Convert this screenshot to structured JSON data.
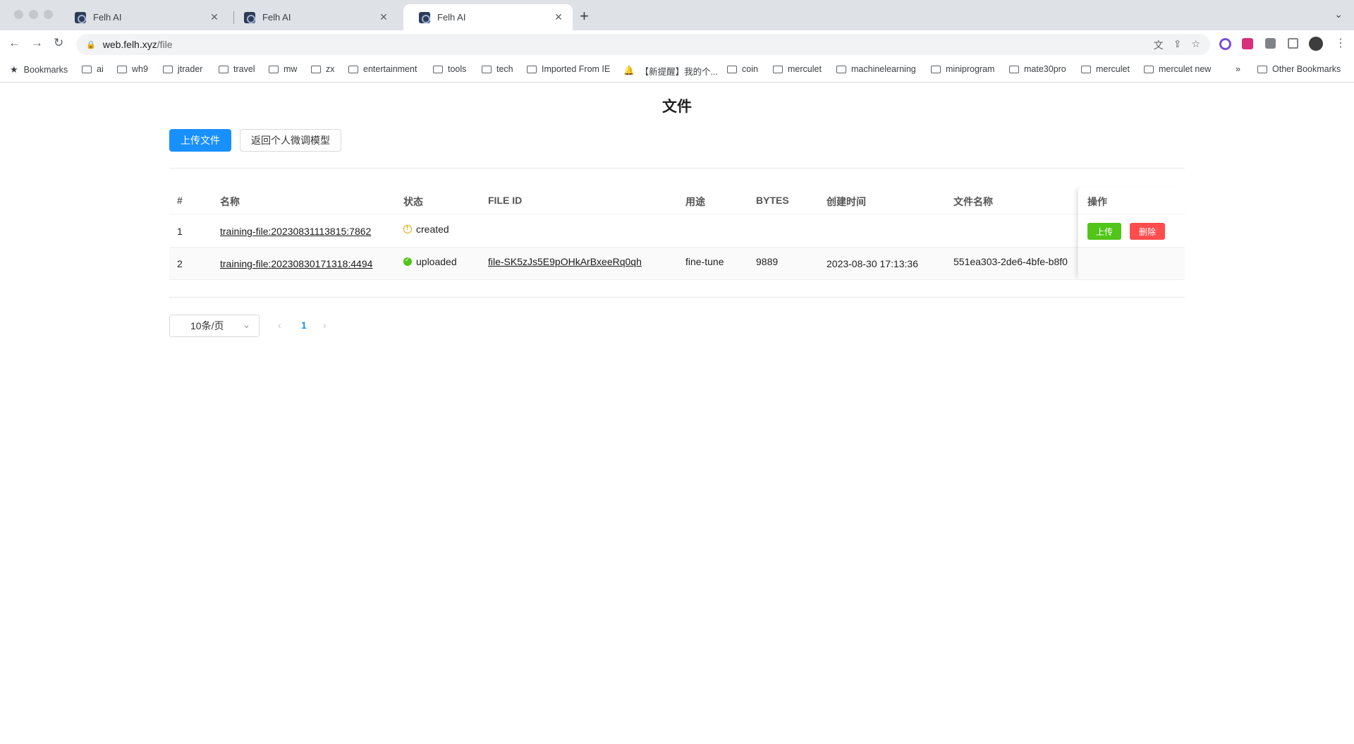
{
  "browser": {
    "tabs": [
      {
        "title": "Felh AI"
      },
      {
        "title": "Felh AI"
      },
      {
        "title": "Felh AI"
      }
    ],
    "url_host": "web.felh.xyz",
    "url_path": "/file",
    "bookmarks_label": "Bookmarks",
    "bookmarks": [
      "ai",
      "wh9",
      "jtrader",
      "travel",
      "mw",
      "zx",
      "entertainment",
      "tools",
      "tech",
      "Imported From IE",
      "【新提醒】我的个...",
      "coin",
      "merculet",
      "machinelearning",
      "miniprogram",
      "mate30pro",
      "merculet",
      "merculet new"
    ],
    "other_bookmarks": "Other Bookmarks",
    "more_glyph": "»"
  },
  "page": {
    "title": "文件",
    "upload_button": "上传文件",
    "back_button": "返回个人微调模型"
  },
  "table": {
    "columns": [
      "#",
      "名称",
      "状态",
      "FILE ID",
      "用途",
      "BYTES",
      "创建时间",
      "文件名称",
      "操作"
    ],
    "rows": [
      {
        "index": "1",
        "name": "training-file:20230831113815:7862",
        "status": "created",
        "file_id": "",
        "purpose": "",
        "bytes": "",
        "created_at": "",
        "file_name": "",
        "action_upload": "上传",
        "action_delete": "删除"
      },
      {
        "index": "2",
        "name": "training-file:20230830171318:4494",
        "status": "uploaded",
        "file_id": "file-SK5zJs5E9pOHkArBxeeRq0qh",
        "purpose": "fine-tune",
        "bytes": "9889",
        "created_at": "2023-08-30 17:13:36",
        "file_name": "551ea303-2de6-4bfe-b8f0"
      }
    ]
  },
  "pagination": {
    "page_size": "10条/页",
    "current_page": "1"
  },
  "colors": {
    "primary": "#1890ff",
    "success": "#52c41a",
    "danger": "#ff4d4f",
    "warning": "#e0a800"
  },
  "icons": {
    "status_created": "warning-circle-icon",
    "status_uploaded": "check-circle-icon"
  }
}
